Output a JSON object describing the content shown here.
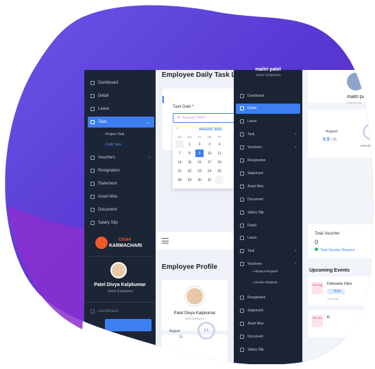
{
  "left_sidebar": {
    "items": [
      {
        "label": "Dashboard",
        "icon": "home-icon"
      },
      {
        "label": "Detail",
        "icon": "user-icon"
      },
      {
        "label": "Leave",
        "icon": "user-minus-icon"
      },
      {
        "label": "Task",
        "icon": "task-icon",
        "active": true
      },
      {
        "label": "Vouchers",
        "icon": "voucher-icon"
      },
      {
        "label": "Resignation",
        "icon": "resign-icon"
      },
      {
        "label": "Statement",
        "icon": "statement-icon"
      },
      {
        "label": "Asset Mov.",
        "icon": "asset-icon"
      },
      {
        "label": "Document",
        "icon": "document-icon"
      },
      {
        "label": "Salary Slip",
        "icon": "salary-icon"
      }
    ],
    "subitems": [
      "Project Task",
      "Daily Task"
    ],
    "logo_text_top": "Click4",
    "logo_text": "KARMACHARI",
    "profile_name": "Patel Divya Kalpkumar",
    "profile_role": "Junior Employee",
    "bottom_item": "Dashboard"
  },
  "main": {
    "title": "Employee Daily Task L",
    "task_date_label": "Task Date *",
    "task_date_placeholder": "01 January 2022",
    "calendar": {
      "month": "AUGUST 2022",
      "days_header": [
        "SU",
        "MO",
        "TU",
        "WE",
        "TH"
      ],
      "rows": [
        [
          "",
          "1",
          "2",
          "3",
          "4"
        ],
        [
          "7",
          "8",
          "9",
          "10",
          "11"
        ],
        [
          "14",
          "15",
          "16",
          "17",
          "18"
        ],
        [
          "21",
          "22",
          "23",
          "24",
          "25"
        ],
        [
          "28",
          "29",
          "30",
          "31",
          ""
        ]
      ],
      "selected": "9"
    },
    "profile_title": "Employee Profile",
    "profile_name": "Patel Divya Kalpkumar",
    "profile_role": "Web Designer",
    "month_label": "August",
    "count": "25",
    "ring_value": "4.5"
  },
  "right_sidebar": {
    "user_name": "maitri patel",
    "user_role": "Junior Employee",
    "items": [
      {
        "label": "Dashboard"
      },
      {
        "label": "Detail",
        "active": true
      },
      {
        "label": "Leave"
      },
      {
        "label": "Task",
        "chevron": true
      },
      {
        "label": "Vouchers",
        "chevron": true
      },
      {
        "label": "Resignation"
      },
      {
        "label": "Statement"
      },
      {
        "label": "Asset Mov."
      },
      {
        "label": "Document"
      },
      {
        "label": "Salary Slip"
      },
      {
        "label": "Detail"
      },
      {
        "label": "Leave"
      },
      {
        "label": "Task",
        "chevron": true
      },
      {
        "label": "Vouchers",
        "chevron": true
      }
    ],
    "subitems": [
      "Advance Request",
      "Voucher Request"
    ],
    "items2": [
      {
        "label": "Resignation"
      },
      {
        "label": "Statement"
      },
      {
        "label": "Asset Mov."
      },
      {
        "label": "Document"
      },
      {
        "label": "Salary Slip"
      }
    ]
  },
  "far_right": {
    "name": "maitri pa",
    "role": "Student Desi",
    "month_label": "August",
    "attendance": "0.5",
    "attendance_total": "25",
    "attend_label": "Attenda",
    "voucher_title": "Total Voucher",
    "voucher_value": "0",
    "voucher_link": "Total Voucher Request",
    "events_title": "Upcoming Events",
    "event1_date": "06 Aug",
    "event1_name": "Dabsania Dipa",
    "event1_tag": "Birth",
    "event1_sub": "Celebrate",
    "event2_date": "08 Oct",
    "event2_name": "R"
  },
  "colors": {
    "accent": "#3d7ef0",
    "sidebar": "#1c2535",
    "blob1": "#5b3fd6",
    "blob2": "#8a2fc9"
  }
}
